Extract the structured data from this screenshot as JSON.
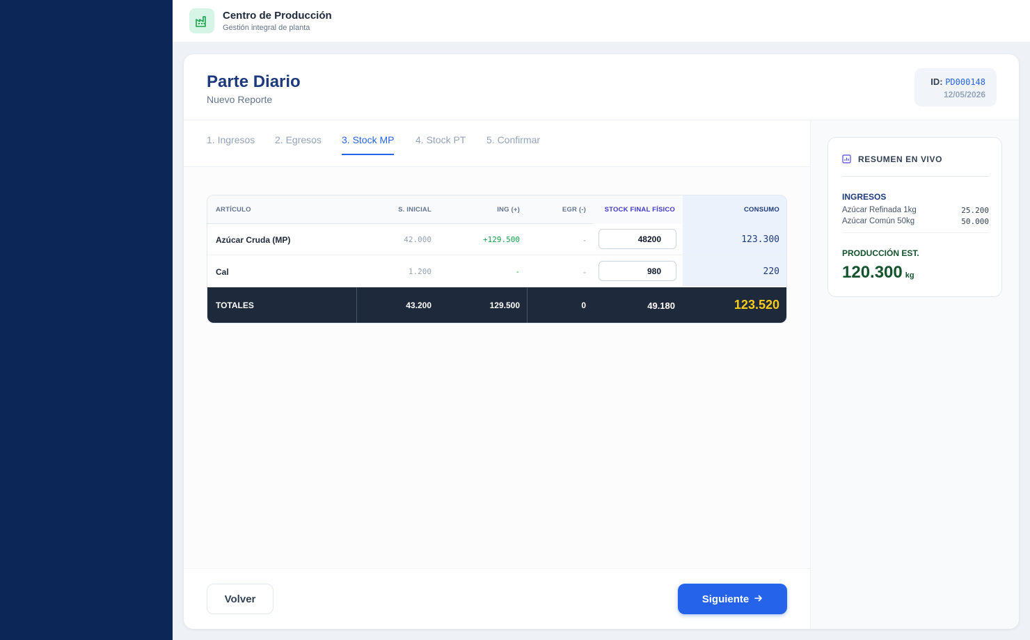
{
  "app": {
    "title": "Centro de Producción",
    "subtitle": "Gestión integral de planta",
    "logo_icon": "factory-icon"
  },
  "report": {
    "title": "Parte Diario",
    "subtitle": "Nuevo Reporte",
    "id_label": "ID:",
    "id_value": "PD000148",
    "date": "12/05/2026"
  },
  "tabs": [
    {
      "label": "1. Ingresos",
      "active": false
    },
    {
      "label": "2. Egresos",
      "active": false
    },
    {
      "label": "3. Stock MP",
      "active": true
    },
    {
      "label": "4. Stock PT",
      "active": false
    },
    {
      "label": "5. Confirmar",
      "active": false
    }
  ],
  "table": {
    "headers": {
      "articulo": "ARTÍCULO",
      "s_inicial": "S. INICIAL",
      "ing": "ING (+)",
      "egr": "EGR (-)",
      "stock_final": "STOCK FINAL FÍSICO",
      "consumo": "CONSUMO"
    },
    "rows": [
      {
        "articulo": "Azúcar Cruda (MP)",
        "s_inicial": "42.000",
        "ing": "+129.500",
        "egr": "-",
        "stock_final": "48200",
        "consumo": "123.300"
      },
      {
        "articulo": "Cal",
        "s_inicial": "1.200",
        "ing": "-",
        "egr": "-",
        "stock_final": "980",
        "consumo": "220"
      }
    ],
    "totals": {
      "label": "TOTALES",
      "s_inicial": "43.200",
      "ing": "129.500",
      "egr": "0",
      "stock_final": "49.180",
      "consumo": "123.520"
    }
  },
  "footer": {
    "back_label": "Volver",
    "next_label": "Siguiente",
    "next_icon": "arrow-right-icon"
  },
  "summary": {
    "title": "RESUMEN EN VIVO",
    "icon": "chart-icon",
    "ingresos_label": "INGRESOS",
    "ingresos_items": [
      {
        "name": "Azúcar Refinada 1kg",
        "value": "25.200"
      },
      {
        "name": "Azúcar Común 50kg",
        "value": "50.000"
      }
    ],
    "produccion_label": "PRODUCCIÓN EST.",
    "produccion_value": "120.300",
    "produccion_unit": "kg"
  },
  "colors": {
    "sidebar": "#0c2657",
    "primary": "#2563eb",
    "title": "#1e3a7b",
    "green": "#16a34a",
    "totals_bg": "#1e293b",
    "totals_accent": "#facc15"
  }
}
